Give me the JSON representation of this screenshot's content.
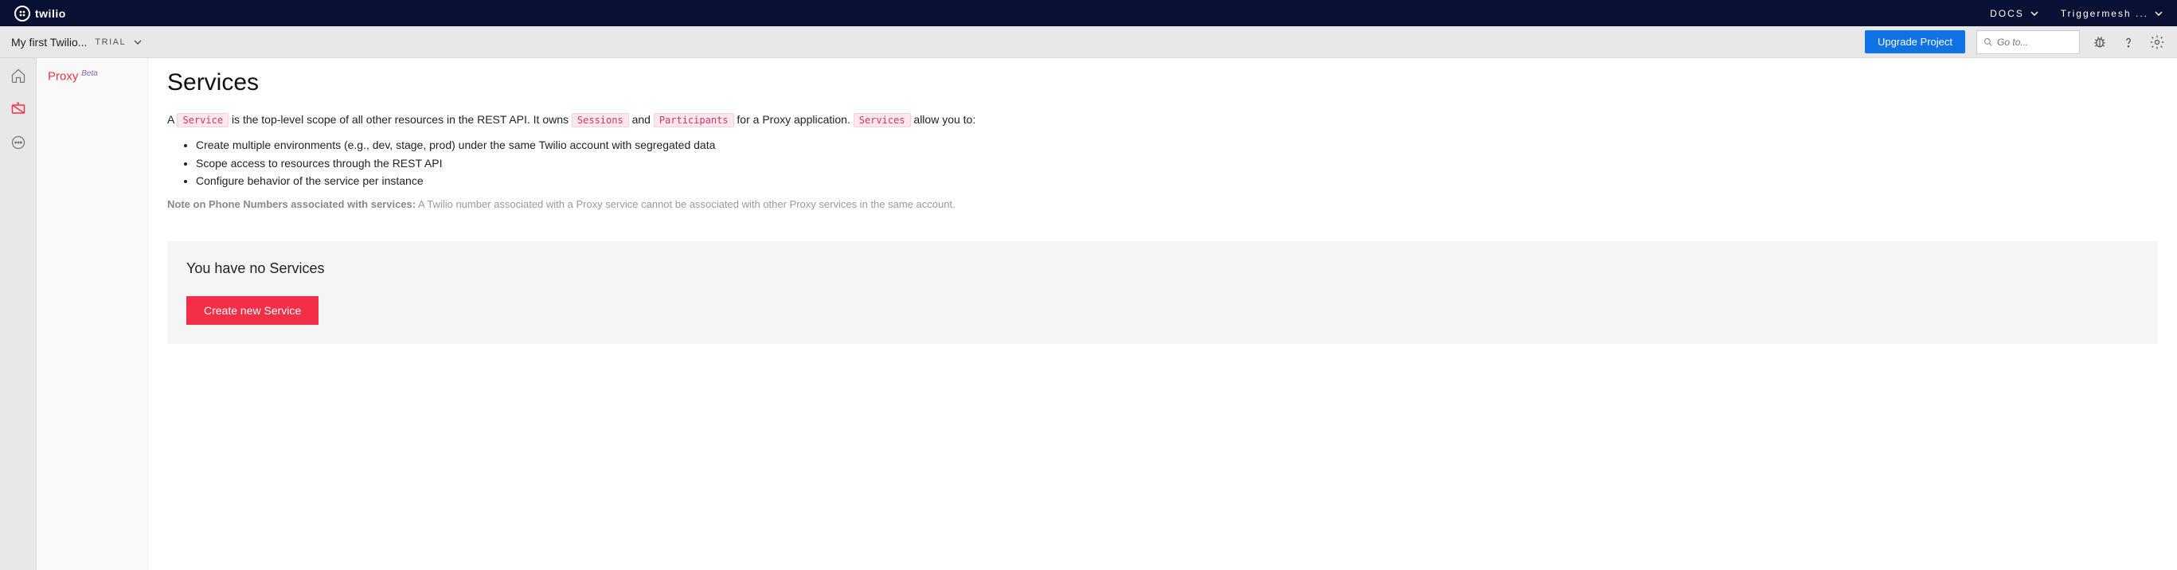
{
  "topbar": {
    "brand": "twilio",
    "docs": "DOCS",
    "account": "Triggermesh ..."
  },
  "subheader": {
    "project_name": "My first Twilio...",
    "trial_label": "TRIAL",
    "upgrade_label": "Upgrade Project",
    "search_placeholder": "Go to..."
  },
  "sidepanel": {
    "title": "Proxy",
    "badge": "Beta"
  },
  "page": {
    "title": "Services",
    "intro_prefix": "A ",
    "pill_service": "Service",
    "intro_mid1": " is the top-level scope of all other resources in the REST API. It owns ",
    "pill_sessions": "Sessions",
    "intro_mid2": " and ",
    "pill_participants": "Participants",
    "intro_mid3": " for a Proxy application. ",
    "pill_services": "Services",
    "intro_suffix": " allow you to:",
    "bullets": [
      "Create multiple environments (e.g., dev, stage, prod) under the same Twilio account with segregated data",
      "Scope access to resources through the REST API",
      "Configure behavior of the service per instance"
    ],
    "note_label": "Note on Phone Numbers associated with services:",
    "note_text": " A Twilio number associated with a Proxy service cannot be associated with other Proxy services in the same account."
  },
  "empty": {
    "title": "You have no Services",
    "create_label": "Create new Service"
  }
}
